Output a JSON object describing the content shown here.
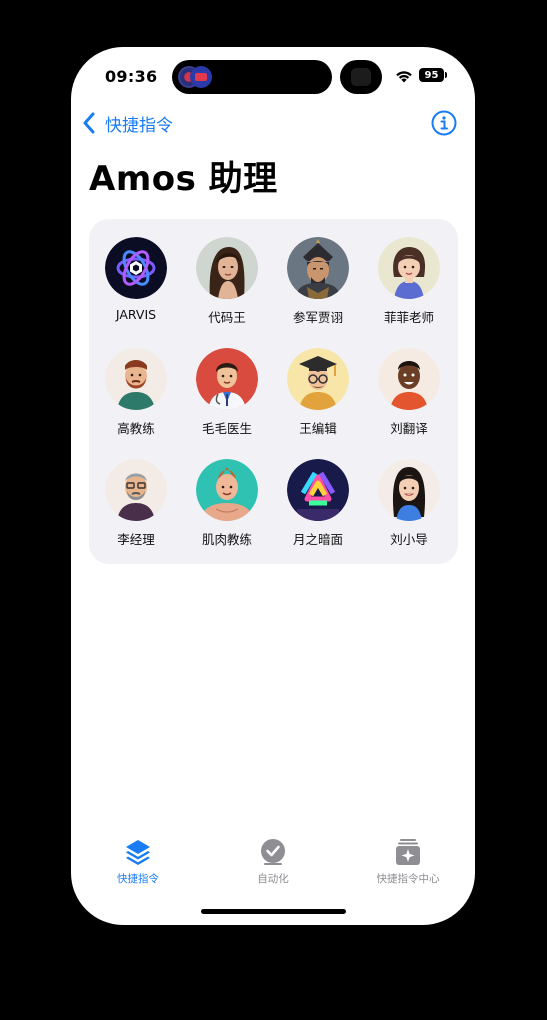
{
  "status_bar": {
    "time": "09:36",
    "battery": "95"
  },
  "nav": {
    "back_label": "快捷指令",
    "back_icon": "chevron-left-icon",
    "info_icon": "info-circle-icon"
  },
  "page": {
    "title": "Amos 助理"
  },
  "shortcuts": [
    {
      "label": "JARVIS",
      "icon": "jarvis-logo"
    },
    {
      "label": "代码王",
      "icon": "woman-portrait"
    },
    {
      "label": "参军贾诩",
      "icon": "warrior-portrait"
    },
    {
      "label": "菲菲老师",
      "icon": "girl-avatar"
    },
    {
      "label": "高教练",
      "icon": "bearded-man-avatar"
    },
    {
      "label": "毛毛医生",
      "icon": "doctor-avatar"
    },
    {
      "label": "王编辑",
      "icon": "graduate-avatar"
    },
    {
      "label": "刘翻译",
      "icon": "man-avatar"
    },
    {
      "label": "李经理",
      "icon": "glasses-man-avatar"
    },
    {
      "label": "肌肉教练",
      "icon": "muscle-man-avatar"
    },
    {
      "label": "月之暗面",
      "icon": "moonshot-logo"
    },
    {
      "label": "刘小导",
      "icon": "long-hair-girl-avatar"
    }
  ],
  "tabbar": {
    "tabs": [
      {
        "label": "快捷指令",
        "icon": "layers-icon",
        "active": true
      },
      {
        "label": "自动化",
        "icon": "checkmark-clock-icon",
        "active": false
      },
      {
        "label": "快捷指令中心",
        "icon": "sparkle-gallery-icon",
        "active": false
      }
    ]
  },
  "colors": {
    "accent": "#1a7cf5",
    "card_bg": "#f1f1f6",
    "inactive": "#8e8e93"
  }
}
